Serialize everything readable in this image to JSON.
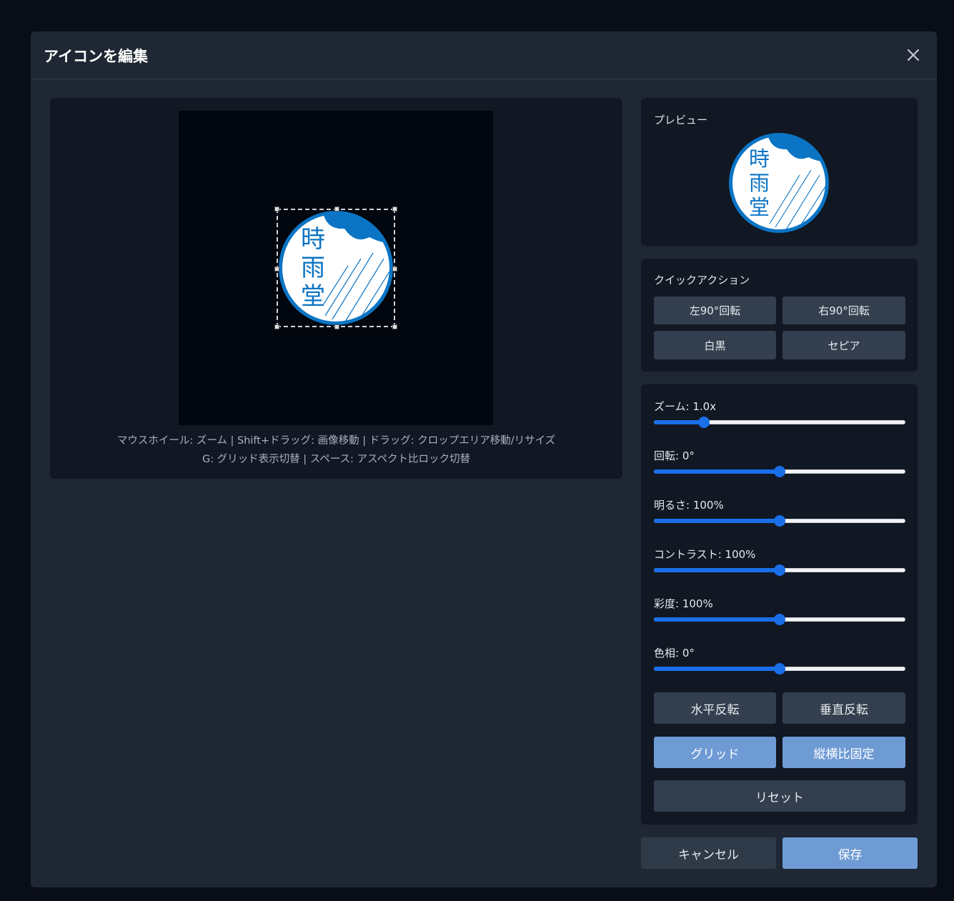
{
  "modal": {
    "title": "アイコンを編集"
  },
  "icon": {
    "chars": [
      "時",
      "雨",
      "堂"
    ],
    "accent": "#0b74c4"
  },
  "hints": {
    "line1": "マウスホイール: ズーム | Shift+ドラッグ: 画像移動 | ドラッグ: クロップエリア移動/リサイズ",
    "line2": "G: グリッド表示切替 | スペース: アスペクト比ロック切替"
  },
  "preview": {
    "title": "プレビュー"
  },
  "quick_actions": {
    "title": "クイックアクション",
    "rotate_left": "左90°回転",
    "rotate_right": "右90°回転",
    "grayscale": "白黒",
    "sepia": "セピア"
  },
  "sliders": [
    {
      "label": "ズーム: 1.0x",
      "value": 0.2
    },
    {
      "label": "回転: 0°",
      "value": 0.5
    },
    {
      "label": "明るさ: 100%",
      "value": 0.5
    },
    {
      "label": "コントラスト: 100%",
      "value": 0.5
    },
    {
      "label": "彩度: 100%",
      "value": 0.5
    },
    {
      "label": "色相: 0°",
      "value": 0.5
    }
  ],
  "controls": {
    "flip_h": "水平反転",
    "flip_v": "垂直反転",
    "grid": "グリッド",
    "aspect_lock": "縦横比固定",
    "reset": "リセット"
  },
  "footer": {
    "cancel": "キャンセル",
    "save": "保存"
  },
  "colors": {
    "active_button": "#6f9bd4",
    "slider_fill": "#1a6fe8"
  }
}
